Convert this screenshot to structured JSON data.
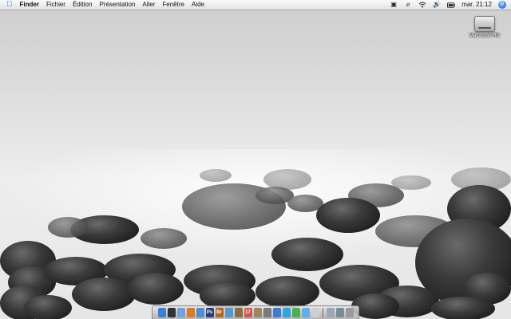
{
  "menubar": {
    "apple_glyph": "",
    "items": [
      "Finder",
      "Fichier",
      "Édition",
      "Présentation",
      "Aller",
      "Fenêtre",
      "Aide"
    ],
    "clock": "mar. 21:12"
  },
  "desktop": {
    "hd_label": "Macintosh HD"
  },
  "dock": {
    "icons": [
      {
        "name": "finder-icon",
        "color": "#3d7fe0",
        "glyph": ""
      },
      {
        "name": "dashboard-icon",
        "color": "#333",
        "glyph": ""
      },
      {
        "name": "mail-icon",
        "color": "#6fa3e6",
        "glyph": ""
      },
      {
        "name": "firefox-icon",
        "color": "#e07a1f",
        "glyph": ""
      },
      {
        "name": "safari-icon",
        "color": "#4a8fd8",
        "glyph": ""
      },
      {
        "name": "photoshop-icon",
        "color": "#1e3f7a",
        "glyph": "Ps"
      },
      {
        "name": "bridge-icon",
        "color": "#b5651d",
        "glyph": "Br"
      },
      {
        "name": "itunes-icon",
        "color": "#4b9cd3",
        "glyph": ""
      },
      {
        "name": "iphoto-icon",
        "color": "#8a6d3b",
        "glyph": ""
      },
      {
        "name": "ical-icon",
        "color": "#d9534f",
        "glyph": "17"
      },
      {
        "name": "address-book-icon",
        "color": "#a0845c",
        "glyph": ""
      },
      {
        "name": "system-preferences-icon",
        "color": "#7a7a7a",
        "glyph": ""
      },
      {
        "name": "app-store-icon",
        "color": "#3a7bd5",
        "glyph": ""
      },
      {
        "name": "skype-icon",
        "color": "#2aa7e0",
        "glyph": ""
      },
      {
        "name": "utility-icon",
        "color": "#4caf50",
        "glyph": ""
      },
      {
        "name": "ichat-icon",
        "color": "#5bb0e8",
        "glyph": ""
      },
      {
        "name": "text-edit-icon",
        "color": "#cfcfcf",
        "glyph": ""
      },
      {
        "name": "preview-icon",
        "color": "#9aa8b8",
        "glyph": ""
      },
      {
        "name": "downloads-icon",
        "color": "#7a8c9a",
        "glyph": ""
      },
      {
        "name": "trash-icon",
        "color": "#9a9a9a",
        "glyph": ""
      }
    ]
  }
}
